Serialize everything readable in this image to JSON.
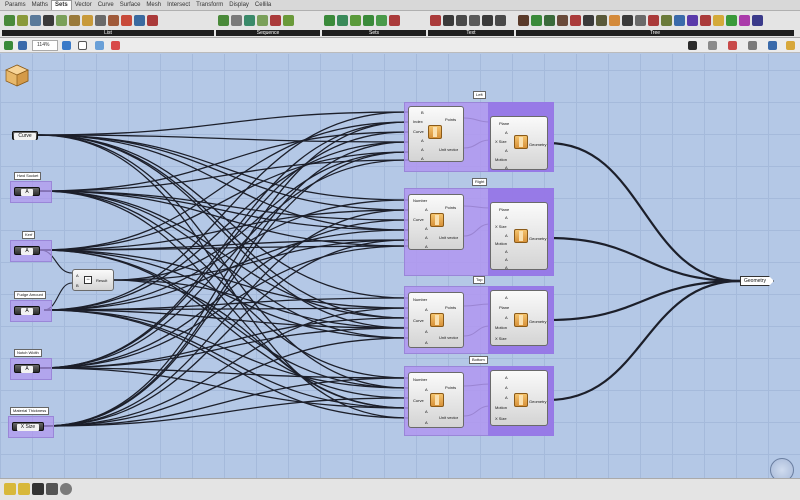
{
  "menubar": {
    "items": [
      "Params",
      "Maths",
      "Sets",
      "Vector",
      "Curve",
      "Surface",
      "Mesh",
      "Intersect",
      "Transform",
      "Display",
      "Cellila"
    ],
    "active": "Sets"
  },
  "ribbon": {
    "groups": [
      "List",
      "Sequence",
      "Sets",
      "Text",
      "Tree"
    ]
  },
  "toolbar": {
    "zoom": "114%"
  },
  "params": {
    "curve": {
      "value": "Curve"
    },
    "hardware": {
      "label": "Hwd Socket",
      "value": "A"
    },
    "kerf": {
      "label": "Kerf",
      "value": "A"
    },
    "fudge": {
      "label": "Fudge Amount",
      "value": "A"
    },
    "notch": {
      "label": "Notch Width",
      "value": "A"
    },
    "material": {
      "label": "Material Thickness",
      "value": "X Size"
    }
  },
  "subtract": {
    "inputs": [
      "A",
      "B"
    ],
    "op": "−",
    "output": "Result"
  },
  "clusters": {
    "left": {
      "label": "Left",
      "c1_inputs": [
        "B",
        "Index",
        "Curve",
        "A",
        "A",
        "A"
      ],
      "c2_inputs": [
        "Plane",
        "A",
        "X Size",
        "A",
        "Motion",
        "A"
      ]
    },
    "right": {
      "label": "Right",
      "c1_inputs": [
        "Number",
        "A",
        "Curve",
        "A",
        "A",
        "A"
      ],
      "c2_inputs": [
        "Plane",
        "A",
        "X Size",
        "A",
        "Motion",
        "A",
        "A",
        "A"
      ]
    },
    "top": {
      "label": "Top",
      "c1_inputs": [
        "Number",
        "A",
        "Curve",
        "A",
        "A"
      ],
      "c2_inputs": [
        "A",
        "Plane",
        "A",
        "Motion",
        "X Size"
      ]
    },
    "bottom": {
      "label": "Bottom",
      "c1_inputs": [
        "Number",
        "A",
        "Curve",
        "A",
        "A"
      ],
      "c2_inputs": [
        "A",
        "A",
        "A",
        "Motion",
        "X Size"
      ]
    },
    "c1_outputs": [
      "Points",
      "Unit vector"
    ],
    "c2_output": "Geometry"
  },
  "output": {
    "label": "Geometry"
  },
  "colors": {
    "canvas": "#b4c8e6",
    "cluster": "#b096f0",
    "wire": "#1c1f2a"
  }
}
